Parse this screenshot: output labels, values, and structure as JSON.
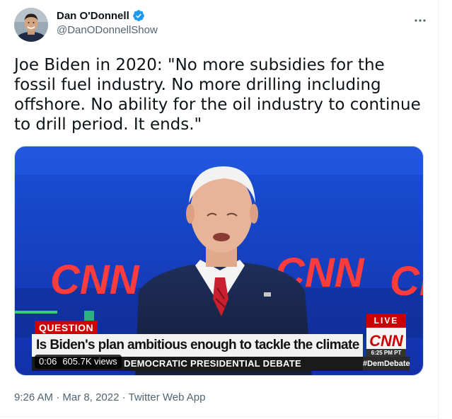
{
  "author": {
    "display_name": "Dan O'Donnell",
    "handle": "@DanODonnellShow",
    "verified": true,
    "avatar_icon": "profile-photo"
  },
  "more_icon": "more-options-icon",
  "tweet": {
    "text": "Joe Biden in 2020: \"No more subsidies for the fossil fuel industry. No more drilling including offshore. No ability for the oil industry to continue to drill period. It ends.\""
  },
  "media": {
    "question_tag": "QUESTION",
    "question_text": "Is Biden's plan ambitious enough to tackle the climate crisis?",
    "debate_text": "DEMOCRATIC PRESIDENTIAL DEBATE",
    "live_label": "LIVE",
    "network_logo": "CNN",
    "broadcast_time": "6:25 PM PT",
    "hashtag": "#DemDebate",
    "background_logos": [
      "CNN",
      "CNN",
      "CN"
    ],
    "video_time": "0:06",
    "views": "605.7K views"
  },
  "meta": {
    "time": "9:26 AM",
    "separator": "·",
    "date": "Mar 8, 2022",
    "source": "Twitter Web App"
  },
  "colors": {
    "verified_blue": "#1d9bf0",
    "secondary_text": "#536471",
    "cnn_red": "#cc0000"
  }
}
